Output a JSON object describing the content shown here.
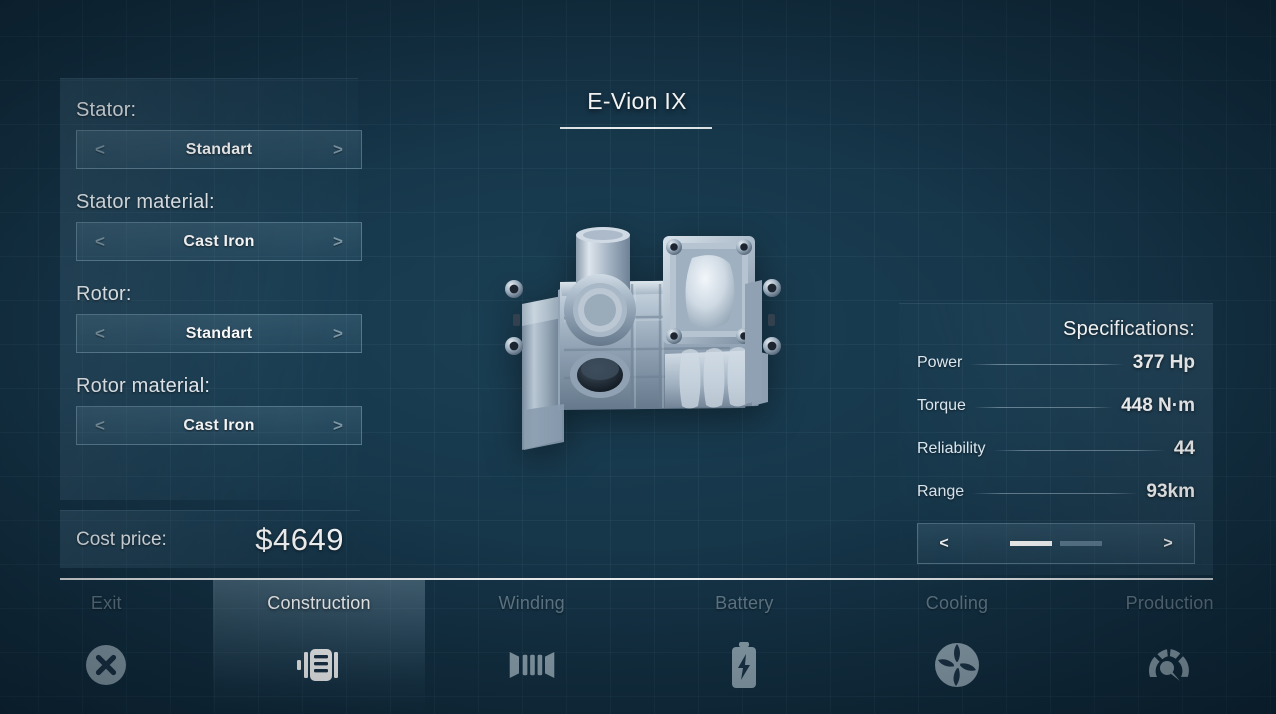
{
  "engine": {
    "title": "E-Vion IX"
  },
  "options": {
    "groups": [
      {
        "label": "Stator:",
        "value": "Standart",
        "prev": "<",
        "next": ">"
      },
      {
        "label": "Stator material:",
        "value": "Cast Iron",
        "prev": "<",
        "next": ">"
      },
      {
        "label": "Rotor:",
        "value": "Standart",
        "prev": "<",
        "next": ">"
      },
      {
        "label": "Rotor material:",
        "value": "Cast Iron",
        "prev": "<",
        "next": ">"
      }
    ]
  },
  "cost": {
    "label": "Cost price:",
    "value": "$4649"
  },
  "specifications": {
    "title": "Specifications:",
    "rows": [
      {
        "name": "Power",
        "value": "377 Hp"
      },
      {
        "name": "Torque",
        "value": "448 N·m"
      },
      {
        "name": "Reliability",
        "value": "44"
      },
      {
        "name": "Range",
        "value": "93km"
      }
    ],
    "pager": {
      "prev": "<",
      "next": ">",
      "pages": 2,
      "current_page": 1
    }
  },
  "nav": {
    "items": [
      {
        "label": "Exit",
        "icon": "close-circle-icon",
        "active": false
      },
      {
        "label": "Construction",
        "icon": "motor-icon",
        "active": true
      },
      {
        "label": "Winding",
        "icon": "coil-icon",
        "active": false
      },
      {
        "label": "Battery",
        "icon": "battery-bolt-icon",
        "active": false
      },
      {
        "label": "Cooling",
        "icon": "fan-icon",
        "active": false
      },
      {
        "label": "Production",
        "icon": "gauge-icon",
        "active": false
      }
    ]
  },
  "colors": {
    "background": "#123047",
    "panel_tint": "#6fa3c0",
    "text_primary": "#ffffff",
    "text_muted": "#96afba",
    "accent_line": "#ffffff",
    "metal_light": "#dfe8ef",
    "metal_mid": "#9eb0bf",
    "metal_dark": "#5d7183"
  }
}
